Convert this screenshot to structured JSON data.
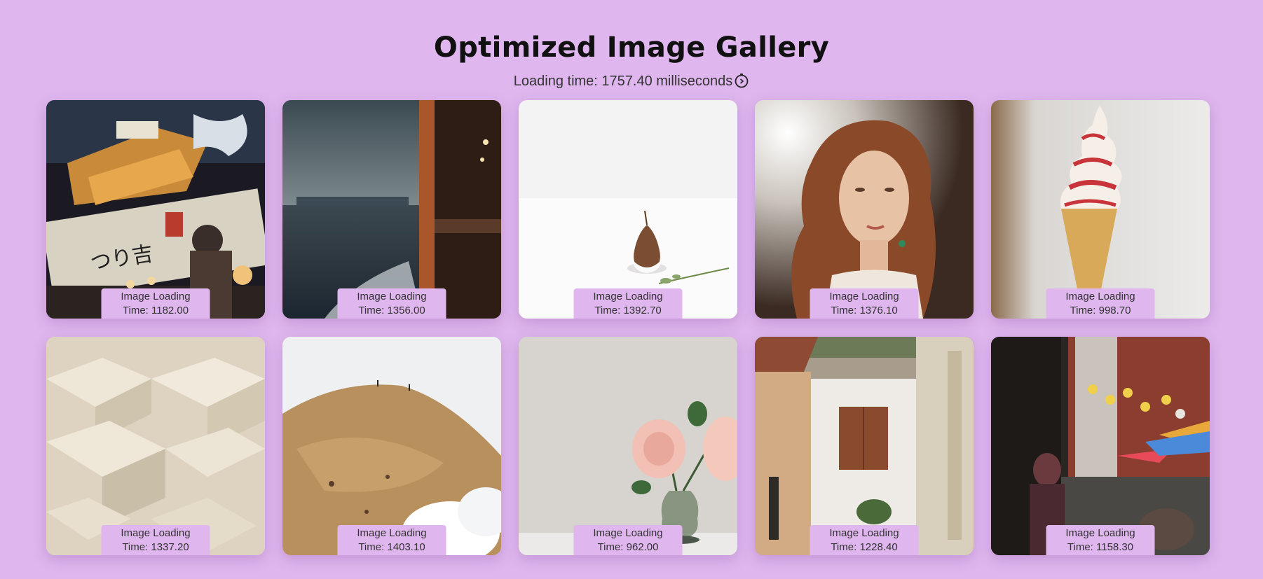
{
  "page": {
    "title": "Optimized Image Gallery",
    "loading_label": "Loading time: 1757.40 milliseconds",
    "stopwatch_icon": "stopwatch-icon"
  },
  "gallery": {
    "caption_line1": "Image Loading",
    "items": [
      {
        "subject": "japanese-restaurant-storefront",
        "time_text": "Time: 1182.00"
      },
      {
        "subject": "stormy-sea-from-ferry",
        "time_text": "Time: 1356.00"
      },
      {
        "subject": "pear-on-white",
        "time_text": "Time: 1392.70"
      },
      {
        "subject": "woman-portrait-sunlight",
        "time_text": "Time: 1376.10"
      },
      {
        "subject": "soft-serve-ice-cream-cone",
        "time_text": "Time: 998.70"
      },
      {
        "subject": "beige-3d-abstract-shapes",
        "time_text": "Time: 1337.20"
      },
      {
        "subject": "hikers-on-hill-with-steam",
        "time_text": "Time: 1403.10"
      },
      {
        "subject": "pink-roses-in-vase",
        "time_text": "Time: 962.00"
      },
      {
        "subject": "old-town-alley",
        "time_text": "Time: 1228.40"
      },
      {
        "subject": "city-street-with-lanterns",
        "time_text": "Time: 1158.30"
      }
    ]
  },
  "colors": {
    "background": "#dfb6ee",
    "caption_bg": "#dfb6ee"
  }
}
